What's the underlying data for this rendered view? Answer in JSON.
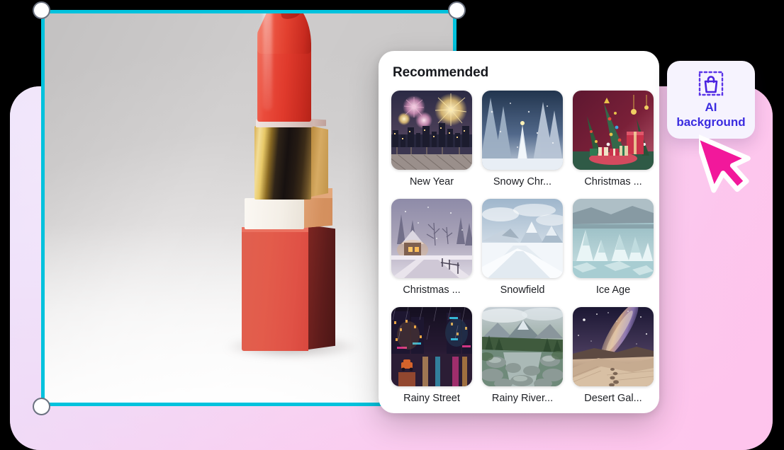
{
  "app": {
    "background_color": "#000000",
    "backdrop_gradient": [
      "#fdf6fd",
      "#f5dff7",
      "#fdc6ec"
    ],
    "accent_cyan": "#00c2dd",
    "accent_purple": "#3b2ce0",
    "cursor_color": "#f2189b"
  },
  "canvas": {
    "name": "product-image-canvas",
    "subject": "red lipstick product photo on light gray studio background",
    "selection": {
      "frame_color": "#00c2dd",
      "handles": [
        "top-left",
        "top-right",
        "bottom-left"
      ]
    }
  },
  "recommended": {
    "title": "Recommended",
    "items": [
      {
        "label": "New Year",
        "icon": "fireworks-city-thumbnail"
      },
      {
        "label": "Snowy Chr...",
        "icon": "snowy-forest-thumbnail"
      },
      {
        "label": "Christmas ...",
        "icon": "christmas-trees-gifts-thumbnail"
      },
      {
        "label": "Christmas ...",
        "icon": "snowy-village-road-thumbnail"
      },
      {
        "label": "Snowfield",
        "icon": "snowfield-mountain-thumbnail"
      },
      {
        "label": "Ice Age",
        "icon": "ice-glacier-thumbnail"
      },
      {
        "label": "Rainy Street",
        "icon": "rainy-night-street-thumbnail"
      },
      {
        "label": "Rainy River...",
        "icon": "rainy-river-rocks-thumbnail"
      },
      {
        "label": "Desert Gal...",
        "icon": "desert-galaxy-thumbnail"
      }
    ]
  },
  "ai_background_button": {
    "icon": "ai-bag-selection-icon",
    "label_line1": "AI",
    "label_line2": "background"
  },
  "cursor": {
    "icon": "arrow-pointer-cursor"
  }
}
